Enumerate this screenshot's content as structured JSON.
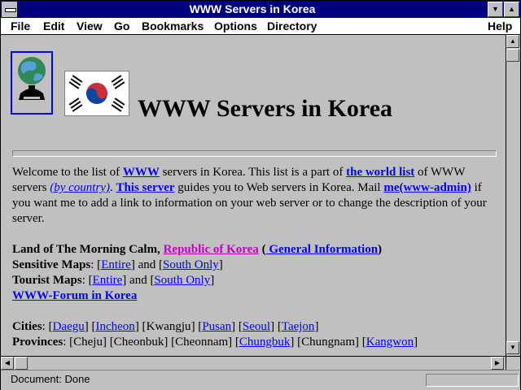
{
  "window": {
    "title": "WWW Servers in Korea"
  },
  "menu": {
    "items": [
      {
        "label": "File"
      },
      {
        "label": "Edit"
      },
      {
        "label": "View"
      },
      {
        "label": "Go"
      },
      {
        "label": "Bookmarks"
      },
      {
        "label": "Options"
      },
      {
        "label": "Directory"
      },
      {
        "label": "Help"
      }
    ]
  },
  "page": {
    "heading": "WWW Servers in Korea",
    "intro": {
      "t1": "Welcome to the list of ",
      "link_www": "WWW",
      "t2": " servers in Korea. This list is a part of ",
      "link_world": "the world list",
      "t3": " of WWW servers ",
      "link_country": "(by country)",
      "t4": ". ",
      "link_this": "This server",
      "t5": " guides you to Web servers in Korea. Mail ",
      "link_mail": "me(www-admin)",
      "t6": " if you want me to add a link to information on your web server or to change the description of your server."
    },
    "land": {
      "label": "Land of The Morning Calm, ",
      "link_rok": "Republic of Korea",
      "open": " (",
      "link_info": " General Information",
      "close": ")"
    },
    "sensitive": {
      "label": "Sensitive Maps",
      "sep": ": [",
      "entire": "Entire",
      "mid": "] and [",
      "south": "South Only",
      "end": "]"
    },
    "tourist": {
      "label": "Tourist Maps",
      "sep": ": [",
      "entire": "Entire",
      "mid": "] and [",
      "south": "South Only",
      "end": "]"
    },
    "forum": "WWW-Forum in Korea",
    "cities": {
      "label": "Cities",
      "items": [
        "Daegu",
        "Incheon",
        "Kwangju",
        "Pusan",
        "Seoul",
        "Taejon"
      ]
    },
    "provinces": {
      "label": "Provinces",
      "items": [
        "Cheju",
        "Cheonbuk",
        "Cheonnam",
        "Chungbuk",
        "Chungnam",
        "Kangwon"
      ]
    }
  },
  "status": {
    "text": "Document: Done"
  },
  "colors": {
    "titlebar": "#000080",
    "link": "#0000ff",
    "visited": "#c000c0",
    "chrome": "#c0c0c0"
  }
}
